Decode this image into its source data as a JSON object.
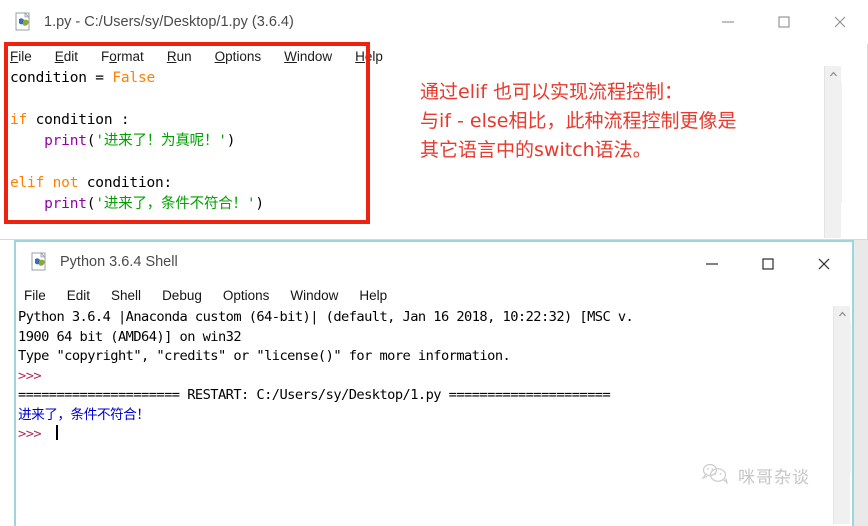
{
  "editor": {
    "title": "1.py - C:/Users/sy/Desktop/1.py (3.6.4)",
    "icon": "python-file-icon",
    "menu": [
      {
        "pre": "",
        "mn": "F",
        "post": "ile"
      },
      {
        "pre": "",
        "mn": "E",
        "post": "dit"
      },
      {
        "pre": "F",
        "mn": "o",
        "post": "rmat"
      },
      {
        "pre": "",
        "mn": "R",
        "post": "un"
      },
      {
        "pre": "",
        "mn": "O",
        "post": "ptions"
      },
      {
        "pre": "",
        "mn": "W",
        "post": "indow"
      },
      {
        "pre": "",
        "mn": "H",
        "post": "elp"
      }
    ],
    "window_controls": {
      "minimize": "minimize-icon",
      "maximize": "maximize-icon",
      "close": "close-icon"
    },
    "code_lines": [
      [
        {
          "t": "condition = ",
          "c": "k-def"
        },
        {
          "t": "False",
          "c": "k-kw"
        }
      ],
      [
        {
          "t": "",
          "c": "k-def"
        }
      ],
      [
        {
          "t": "if",
          "c": "k-kw"
        },
        {
          "t": " condition :",
          "c": "k-def"
        }
      ],
      [
        {
          "t": "    ",
          "c": "k-def"
        },
        {
          "t": "print",
          "c": "k-fn"
        },
        {
          "t": "(",
          "c": "k-def"
        },
        {
          "t": "'进来了！为真呢！'",
          "c": "k-str"
        },
        {
          "t": ")",
          "c": "k-def"
        }
      ],
      [
        {
          "t": "",
          "c": "k-def"
        }
      ],
      [
        {
          "t": "elif not",
          "c": "k-kw"
        },
        {
          "t": " condition:",
          "c": "k-def"
        }
      ],
      [
        {
          "t": "    ",
          "c": "k-def"
        },
        {
          "t": "print",
          "c": "k-fn"
        },
        {
          "t": "(",
          "c": "k-def"
        },
        {
          "t": "'进来了，条件不符合！'",
          "c": "k-str"
        },
        {
          "t": ")",
          "c": "k-def"
        }
      ]
    ]
  },
  "annotation": {
    "color": "#e8392c",
    "lines": [
      "通过elif 也可以实现流程控制：",
      "与if - else相比，此种流程控制更像是",
      "其它语言中的switch语法。"
    ]
  },
  "shell": {
    "title": "Python 3.6.4 Shell",
    "icon": "python-file-icon",
    "menu": [
      {
        "pre": "",
        "mn": "",
        "post": "File"
      },
      {
        "pre": "",
        "mn": "",
        "post": "Edit"
      },
      {
        "pre": "",
        "mn": "",
        "post": "Shell"
      },
      {
        "pre": "",
        "mn": "",
        "post": "Debug"
      },
      {
        "pre": "",
        "mn": "",
        "post": "Options"
      },
      {
        "pre": "",
        "mn": "",
        "post": "Window"
      },
      {
        "pre": "",
        "mn": "",
        "post": "Help"
      }
    ],
    "window_controls": {
      "minimize": "minimize-icon",
      "maximize": "maximize-icon",
      "close": "close-icon"
    },
    "output_lines": [
      [
        {
          "t": "Python 3.6.4 |Anaconda custom (64-bit)| (default, Jan 16 2018, 10:22:32) [MSC v.",
          "c": "sh-plain"
        }
      ],
      [
        {
          "t": "1900 64 bit (AMD64)] on win32",
          "c": "sh-plain"
        }
      ],
      [
        {
          "t": "Type \"copyright\", \"credits\" or \"license()\" for more information.",
          "c": "sh-plain"
        }
      ],
      [
        {
          "t": ">>> ",
          "c": "sh-prompt"
        }
      ],
      [
        {
          "t": "===================== RESTART: C:/Users/sy/Desktop/1.py =====================",
          "c": "sh-plain"
        }
      ],
      [
        {
          "t": "进来了，条件不符合！",
          "c": "sh-out"
        }
      ],
      [
        {
          "t": ">>> ",
          "c": "sh-prompt"
        },
        {
          "t": "\u0000CARET",
          "c": "caret-slot"
        }
      ]
    ]
  },
  "watermark": {
    "text": "咪哥杂谈",
    "icon": "chat-bubble-icon"
  },
  "scrollbars": {
    "up_arrow": "chevron-up-icon",
    "down_arrow": "chevron-down-icon"
  }
}
